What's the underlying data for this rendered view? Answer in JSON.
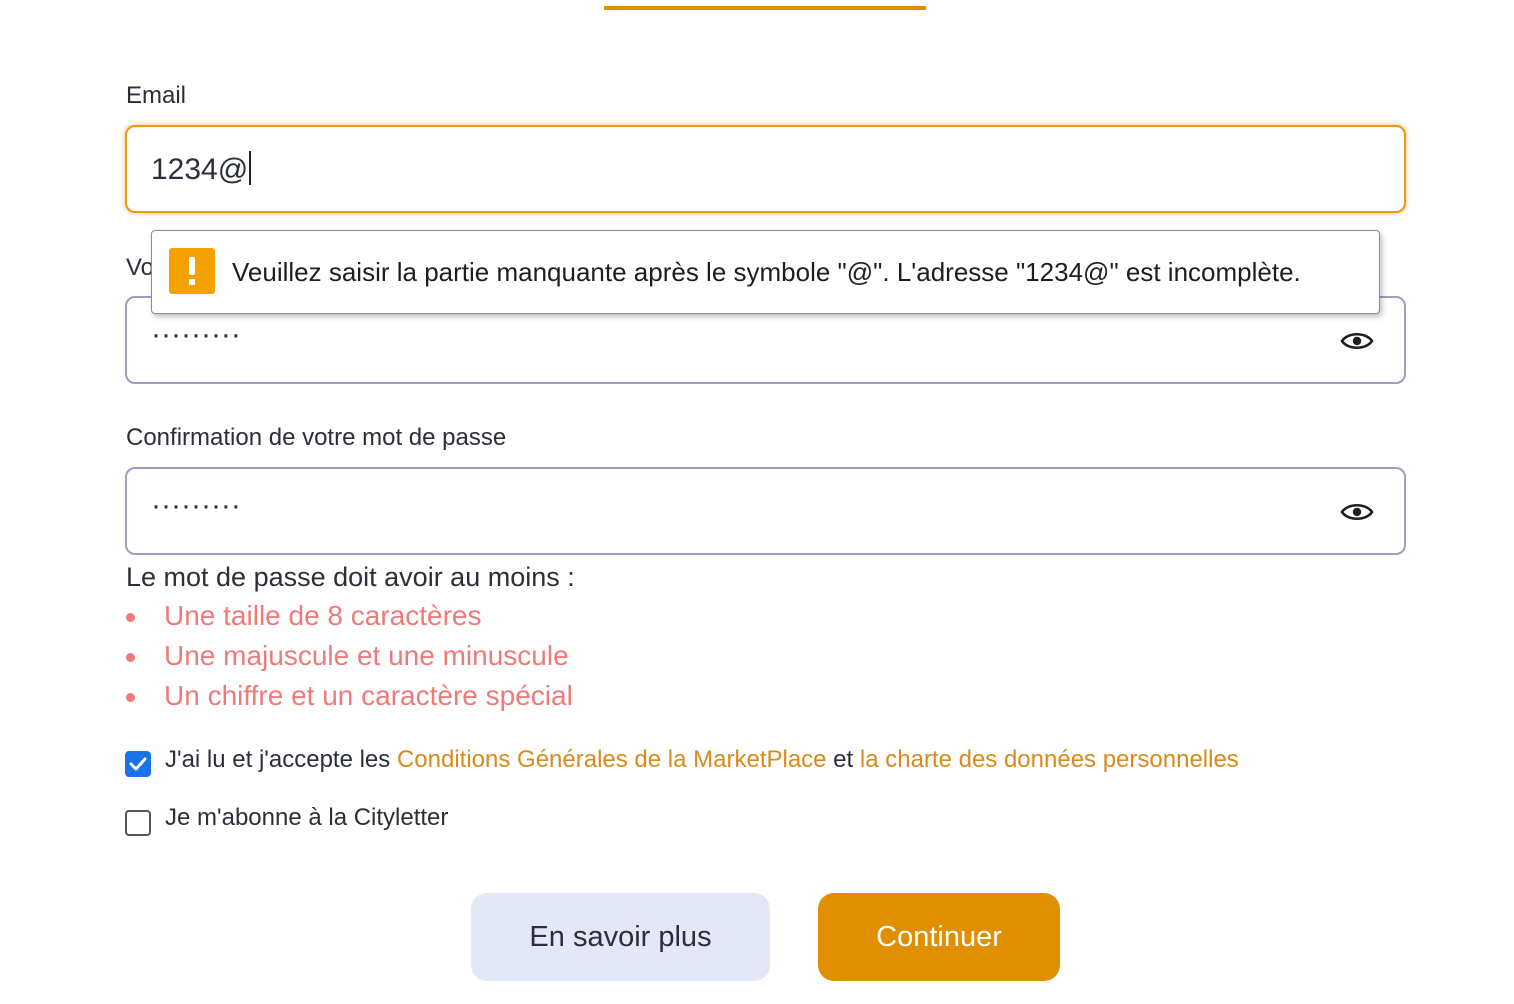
{
  "form": {
    "email_label": "Email",
    "email_value": "1234@",
    "password_label_partial": "Vo",
    "password_value": "·········",
    "confirm_label": "Confirmation de votre mot de passe",
    "confirm_value": "·········"
  },
  "validation_tooltip": {
    "message": "Veuillez saisir la partie manquante après le symbole \"@\". L'adresse \"1234@\" est incomplète.",
    "icon": "warning-icon"
  },
  "password_rules": {
    "title": "Le mot de passe doit avoir au moins :",
    "items": [
      "Une taille de 8 caractères",
      "Une majuscule et une minuscule",
      "Un chiffre et un caractère spécial"
    ]
  },
  "terms": {
    "prefix": "J'ai lu et j'accepte les ",
    "link1": "Conditions Générales de la MarketPlace",
    "middle": " et ",
    "link2": "la charte des données personnelles",
    "checked": true
  },
  "newsletter": {
    "label": "Je m'abonne à la Cityletter",
    "checked": false
  },
  "buttons": {
    "more": "En savoir plus",
    "continue": "Continuer"
  },
  "colors": {
    "accent": "#e08f00",
    "error": "#f07a7a",
    "link": "#d98a1c",
    "checkbox": "#1a73e8"
  }
}
